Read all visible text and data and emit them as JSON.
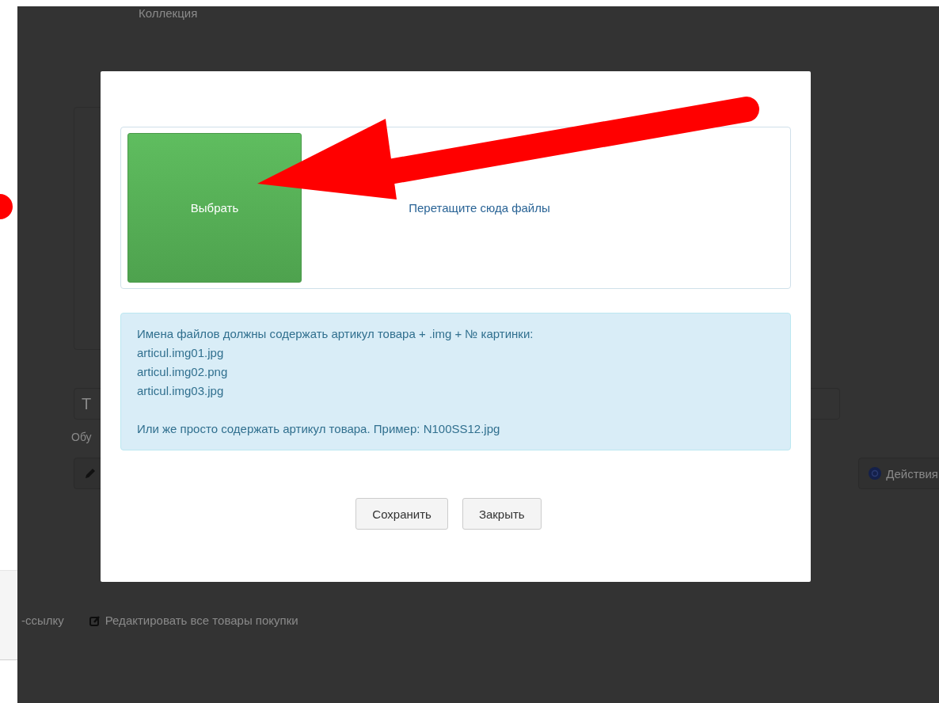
{
  "background_page": {
    "collection_label": "Коллекция",
    "field_value": "Т",
    "field_hint": "Обу",
    "actions_button": "Действия",
    "link_fragment": "-ссылку",
    "edit_all_link": "Редактировать все товары покупки"
  },
  "modal": {
    "choose_button": "Выбрать",
    "drop_zone": "Перетащите сюда файлы",
    "info_paragraphs": [
      {
        "lines": [
          "Имена файлов должны содержать артикул товара + .img + № картинки:",
          "articul.img01.jpg",
          "articul.img02.png",
          "articul.img03.jpg"
        ]
      },
      {
        "lines": [
          "Или же просто содержать артикул товара. Пример: N100SS12.jpg"
        ]
      }
    ],
    "buttons": [
      "Сохранить",
      "Закрыть"
    ]
  }
}
